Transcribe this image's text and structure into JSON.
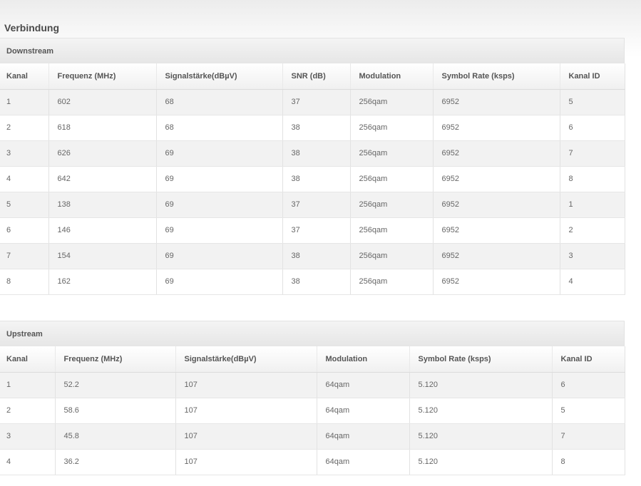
{
  "page": {
    "title": "Verbindung"
  },
  "downstream": {
    "title": "Downstream",
    "headers": [
      "Kanal",
      "Frequenz (MHz)",
      "Signalstärke(dBµV)",
      "SNR (dB)",
      "Modulation",
      "Symbol Rate (ksps)",
      "Kanal ID"
    ],
    "rows": [
      [
        "1",
        "602",
        "68",
        "37",
        "256qam",
        "6952",
        "5"
      ],
      [
        "2",
        "618",
        "68",
        "38",
        "256qam",
        "6952",
        "6"
      ],
      [
        "3",
        "626",
        "69",
        "38",
        "256qam",
        "6952",
        "7"
      ],
      [
        "4",
        "642",
        "69",
        "38",
        "256qam",
        "6952",
        "8"
      ],
      [
        "5",
        "138",
        "69",
        "37",
        "256qam",
        "6952",
        "1"
      ],
      [
        "6",
        "146",
        "69",
        "37",
        "256qam",
        "6952",
        "2"
      ],
      [
        "7",
        "154",
        "69",
        "38",
        "256qam",
        "6952",
        "3"
      ],
      [
        "8",
        "162",
        "69",
        "38",
        "256qam",
        "6952",
        "4"
      ]
    ]
  },
  "upstream": {
    "title": "Upstream",
    "headers": [
      "Kanal",
      "Frequenz (MHz)",
      "Signalstärke(dBµV)",
      "Modulation",
      "Symbol Rate (ksps)",
      "Kanal ID"
    ],
    "rows": [
      [
        "1",
        "52.2",
        "107",
        "64qam",
        "5.120",
        "6"
      ],
      [
        "2",
        "58.6",
        "107",
        "64qam",
        "5.120",
        "5"
      ],
      [
        "3",
        "45.8",
        "107",
        "64qam",
        "5.120",
        "7"
      ],
      [
        "4",
        "36.2",
        "107",
        "64qam",
        "5.120",
        "8"
      ]
    ]
  }
}
